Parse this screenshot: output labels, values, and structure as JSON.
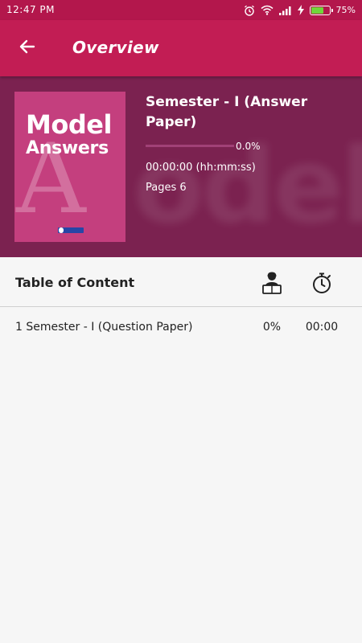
{
  "status_bar": {
    "time": "12:47 PM",
    "battery_percent": "75%",
    "icons": [
      "alarm-icon",
      "wifi-icon",
      "signal-icon",
      "charging-icon",
      "battery-icon"
    ],
    "battery_level": 0.75,
    "battery_color": "#6fd63a"
  },
  "app_bar": {
    "title": "Overview",
    "back_icon": "arrow-left-icon",
    "color": "#c21d54"
  },
  "book": {
    "cover_title_line1": "Model",
    "cover_title_line2": "Answers",
    "cover_big_letter": "A",
    "title": "Semester - I (Answer Paper)",
    "progress_value": 0.0,
    "progress_label": "0.0%",
    "time_spent": "00:00:00 (hh:mm:ss)",
    "pages": "Pages 6",
    "band_color": "#7b2250",
    "cover_color": "#c43f7e"
  },
  "toc": {
    "title": "Table of Content",
    "reader_icon": "reader-icon",
    "timer_icon": "stopwatch-icon",
    "rows": [
      {
        "title": "1 Semester - I (Question Paper)",
        "percent": "0%",
        "time": "00:00"
      }
    ]
  }
}
